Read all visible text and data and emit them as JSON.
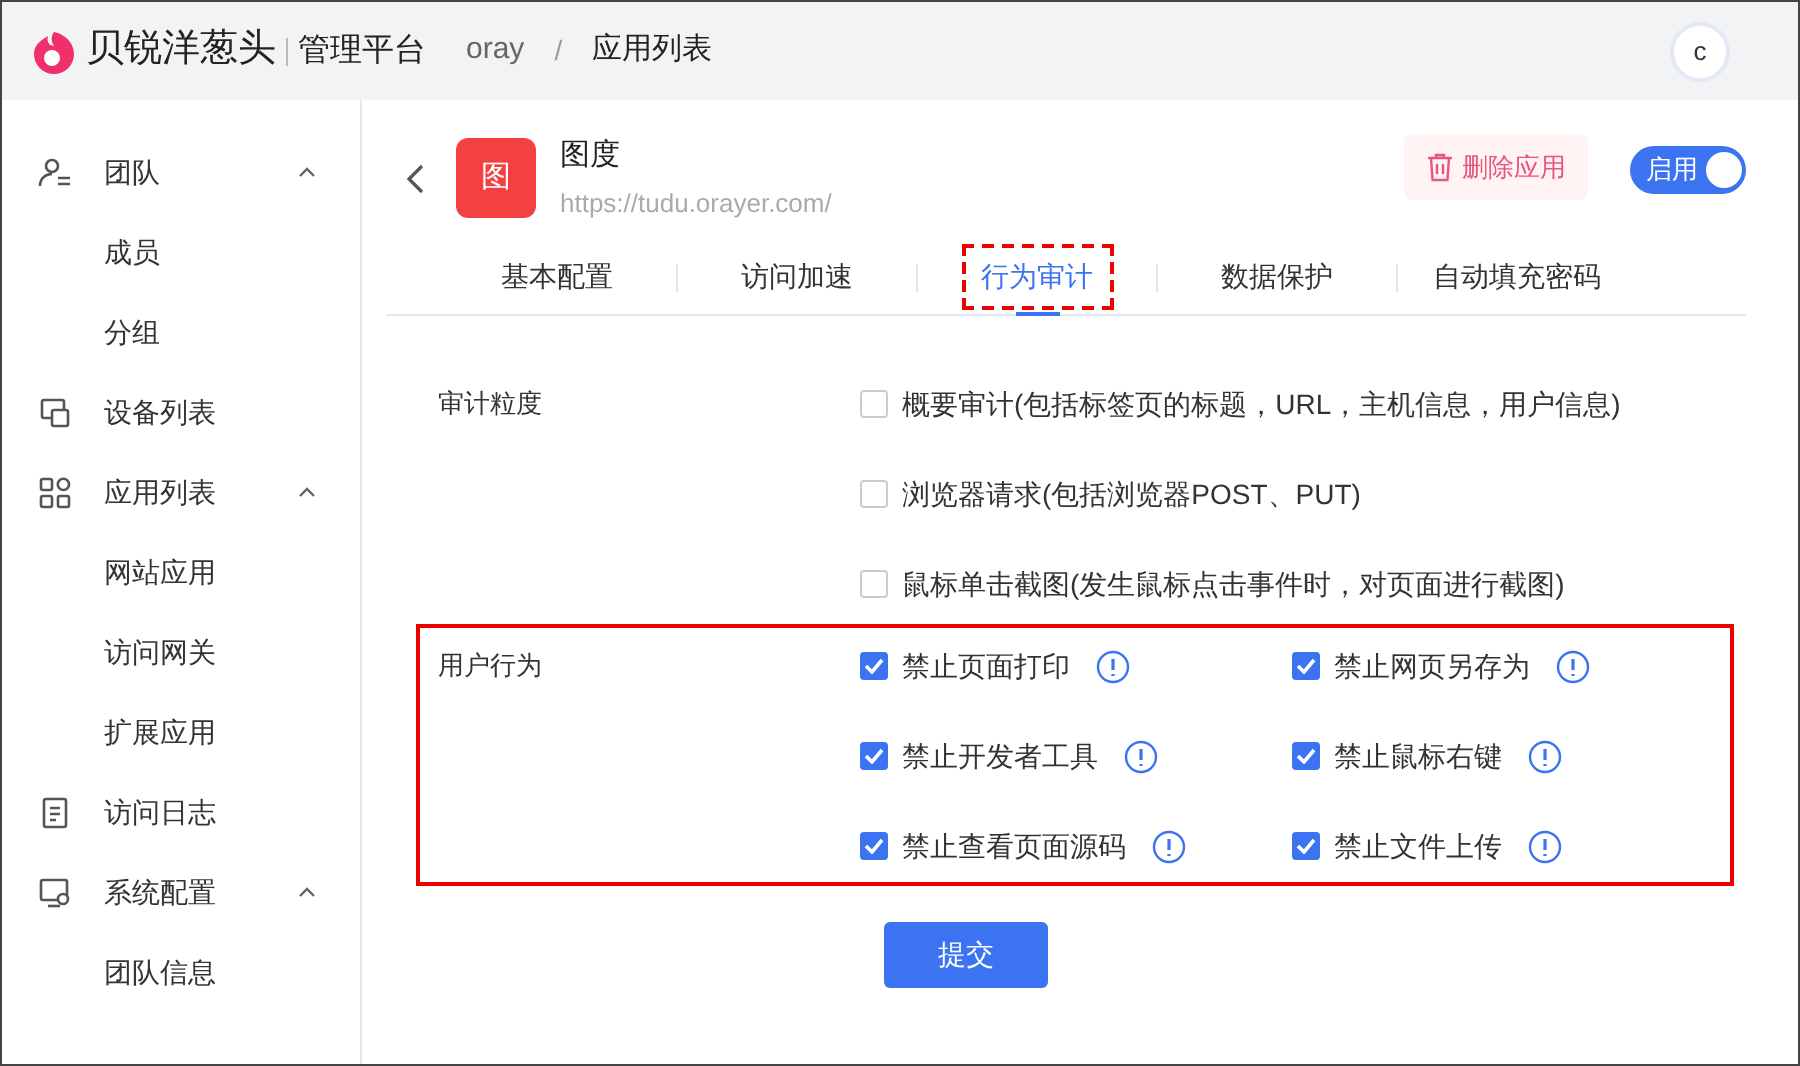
{
  "header": {
    "brand": "贝锐洋葱头",
    "product": "管理平台",
    "breadcrumb": [
      "oray",
      "应用列表"
    ],
    "breadcrumb_separator": "/",
    "avatar": "c"
  },
  "sidebar": {
    "items": [
      {
        "label": "团队",
        "expanded": true,
        "children": [
          {
            "label": "成员"
          },
          {
            "label": "分组"
          }
        ]
      },
      {
        "label": "设备列表"
      },
      {
        "label": "应用列表",
        "expanded": true,
        "children": [
          {
            "label": "网站应用"
          },
          {
            "label": "访问网关"
          },
          {
            "label": "扩展应用"
          }
        ]
      },
      {
        "label": "访问日志"
      },
      {
        "label": "系统配置",
        "expanded": true,
        "children": [
          {
            "label": "团队信息"
          }
        ]
      }
    ]
  },
  "app": {
    "icon_text": "图",
    "name": "图度",
    "url": "https://tudu.orayer.com/",
    "delete_button": "删除应用",
    "toggle": {
      "label": "启用",
      "on": true
    }
  },
  "tabs": [
    {
      "label": "基本配置",
      "selected": false,
      "highlighted": false
    },
    {
      "label": "访问加速",
      "selected": false,
      "highlighted": false
    },
    {
      "label": "行为审计",
      "selected": true,
      "highlighted": true
    },
    {
      "label": "数据保护",
      "selected": false,
      "highlighted": false
    },
    {
      "label": "自动填充密码",
      "selected": false,
      "highlighted": false
    }
  ],
  "sections": [
    {
      "label": "审计粒度",
      "highlighted": false,
      "options": [
        {
          "label": "概要审计(包括标签页的标题，URL，主机信息，用户信息)",
          "checked": false,
          "info": false
        },
        {
          "label": "浏览器请求(包括浏览器POST、PUT)",
          "checked": false,
          "info": false
        },
        {
          "label": "鼠标单击截图(发生鼠标点击事件时，对页面进行截图)",
          "checked": false,
          "info": false
        }
      ]
    },
    {
      "label": "用户行为",
      "highlighted": true,
      "options": [
        {
          "label": "禁止页面打印",
          "checked": true,
          "info": true
        },
        {
          "label": "禁止网页另存为",
          "checked": true,
          "info": true
        },
        {
          "label": "禁止开发者工具",
          "checked": true,
          "info": true
        },
        {
          "label": "禁止鼠标右键",
          "checked": true,
          "info": true
        },
        {
          "label": "禁止查看页面源码",
          "checked": true,
          "info": true
        },
        {
          "label": "禁止文件上传",
          "checked": true,
          "info": true
        }
      ]
    }
  ],
  "submit": "提交"
}
